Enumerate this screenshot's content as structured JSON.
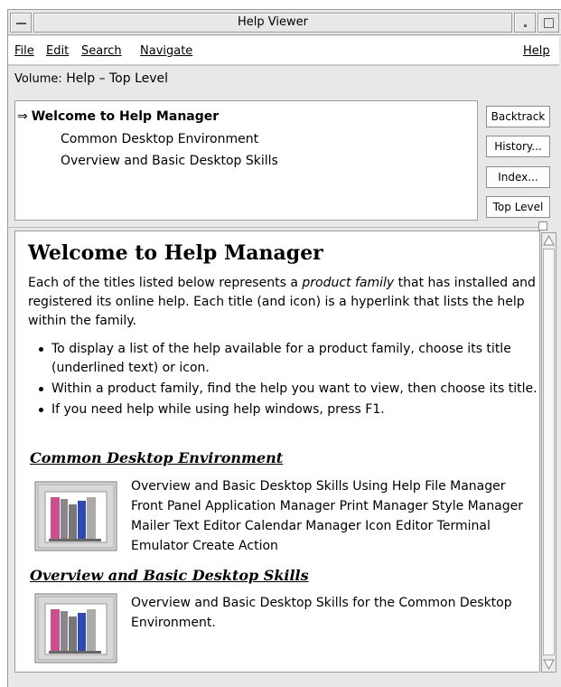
{
  "window": {
    "title": "Help Viewer"
  },
  "menubar": {
    "file": "File",
    "edit": "Edit",
    "search": "Search",
    "navigate": "Navigate",
    "help": "Help"
  },
  "volume": {
    "label": "Volume:",
    "value": "Help – Top Level"
  },
  "toc": {
    "current_marker": "⇒",
    "items": [
      "Welcome to Help Manager",
      "Common Desktop Environment",
      "Overview and Basic Desktop Skills"
    ]
  },
  "buttons": {
    "backtrack": "Backtrack",
    "history": "History...",
    "index": "Index...",
    "top_level": "Top Level"
  },
  "content": {
    "heading": "Welcome to Help Manager",
    "intro_1": "Each of the titles listed below represents a ",
    "intro_emph": "product family",
    "intro_2": " that has installed and registered its online help. Each title (and icon) is a hyperlink that lists the help within the family.",
    "bullets": [
      "To display a list of the help available for a product family, choose its title (underlined text) or icon.",
      "Within a product family, find the help you want to view, then choose its title.",
      "If you need help while using help windows, press F1."
    ],
    "families": [
      {
        "title": "Common Desktop Environment",
        "text": "Overview and Basic Desktop Skills Using Help File Manager Front Panel Application Manager Print Manager Style Manager Mailer Text Editor Calendar Manager Icon Editor Terminal Emulator Create Action"
      },
      {
        "title": "Overview and Basic Desktop Skills",
        "text": "Overview and Basic Desktop Skills for the Common Desktop Environment."
      }
    ]
  },
  "icons": {
    "window_menu": "window-menu-icon",
    "minimize": "minimize-icon",
    "maximize": "maximize-icon",
    "book": "book-shelf-icon",
    "scroll_up": "scroll-up-arrow-icon",
    "scroll_down": "scroll-down-arrow-icon"
  }
}
